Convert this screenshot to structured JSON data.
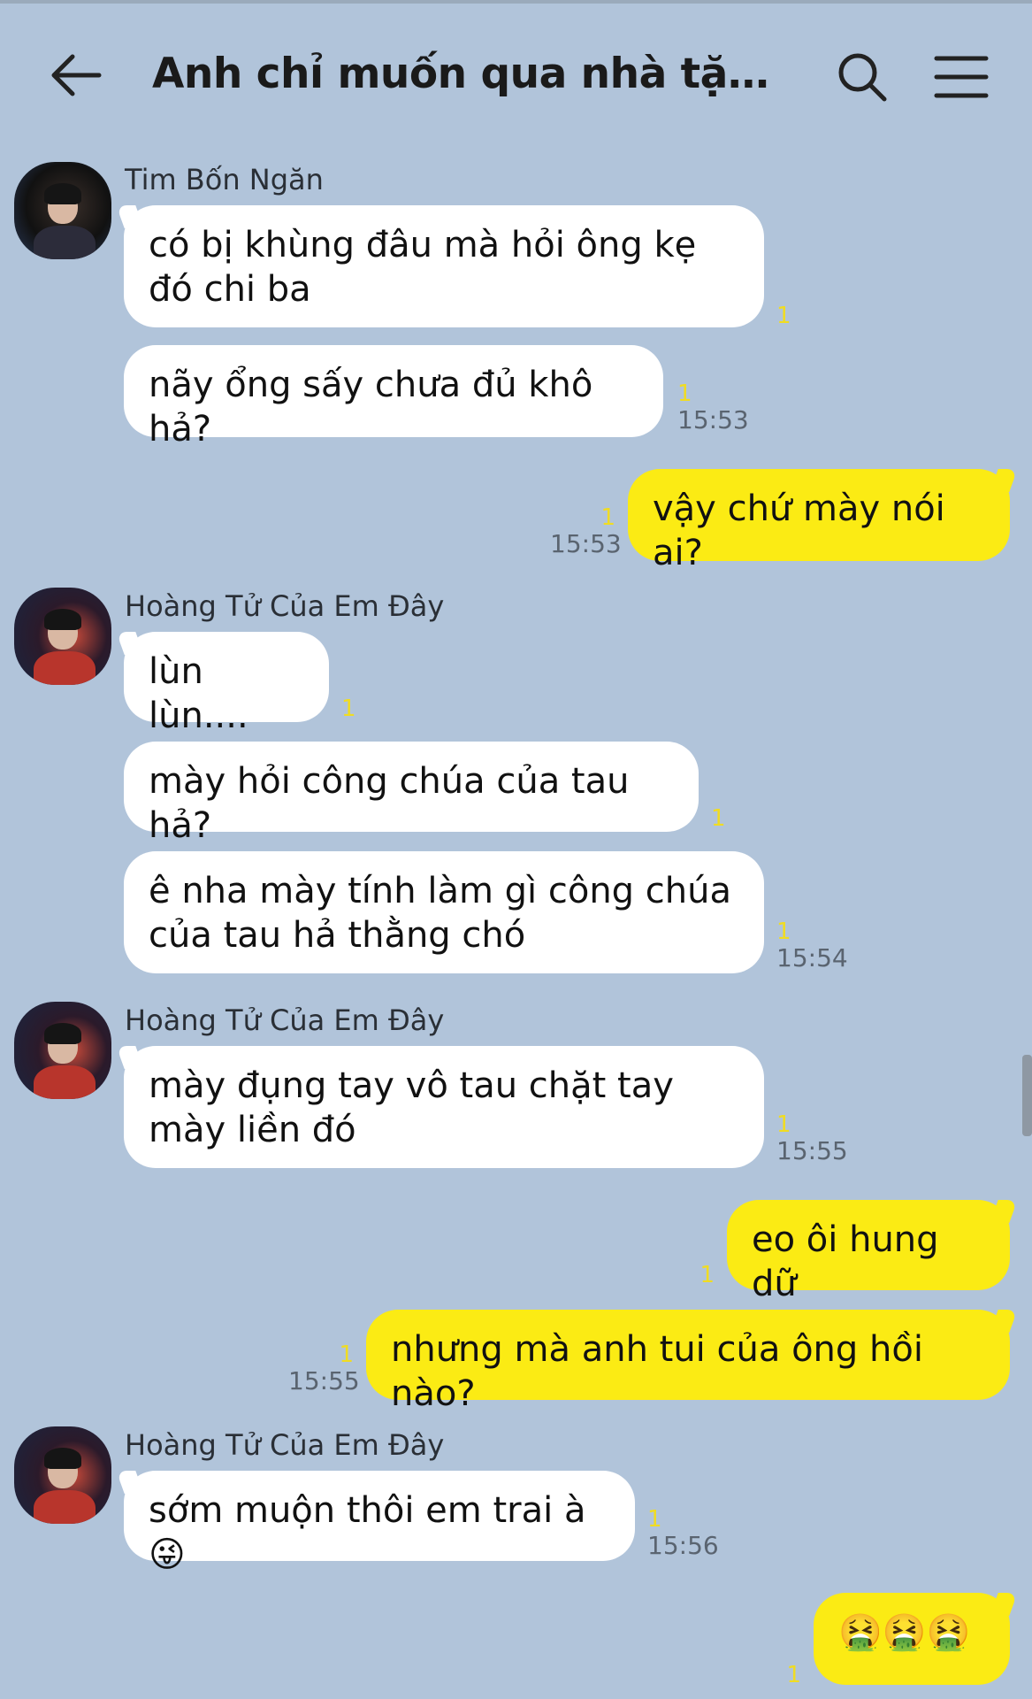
{
  "header": {
    "title": "Anh chỉ muốn qua nhà tặng c...",
    "back_icon": "arrow-left-icon",
    "search_icon": "search-icon",
    "menu_icon": "menu-icon"
  },
  "colors": {
    "background": "#b1c4da",
    "incoming_bubble": "#ffffff",
    "outgoing_bubble": "#fbeb14",
    "unread_count": "#f0dc22"
  },
  "messages": [
    {
      "sender": "Tim Bốn Ngăn",
      "text": "có bị khùng đâu mà hỏi ông kẹ đó chi ba",
      "count": "1",
      "time": ""
    },
    {
      "text": "nãy ổng sấy chưa đủ khô hả?",
      "count": "1",
      "time": "15:53"
    },
    {
      "text": "vậy chứ mày nói ai?",
      "count": "1",
      "time": "15:53"
    },
    {
      "sender": "Hoàng Tử Của Em Đây",
      "text": "lùn lùn....",
      "count": "1",
      "time": ""
    },
    {
      "text": "mày hỏi công chúa của tau hả?",
      "count": "1",
      "time": ""
    },
    {
      "text": "ê nha mày tính làm gì công chúa của tau hả thằng chó",
      "count": "1",
      "time": "15:54"
    },
    {
      "sender": "Hoàng Tử Của Em Đây",
      "text": "mày đụng tay vô tau chặt tay mày liền đó",
      "count": "1",
      "time": "15:55"
    },
    {
      "text": "eo ôi hung dữ",
      "count": "1",
      "time": ""
    },
    {
      "text": "nhưng mà anh tui của ông hồi nào?",
      "count": "1",
      "time": "15:55"
    },
    {
      "sender": "Hoàng Tử Của Em Đây",
      "text": "sớm muộn thôi em trai à😜",
      "count": "1",
      "time": "15:56"
    },
    {
      "text": "🤮🤮🤮",
      "count": "1",
      "time": ""
    }
  ]
}
